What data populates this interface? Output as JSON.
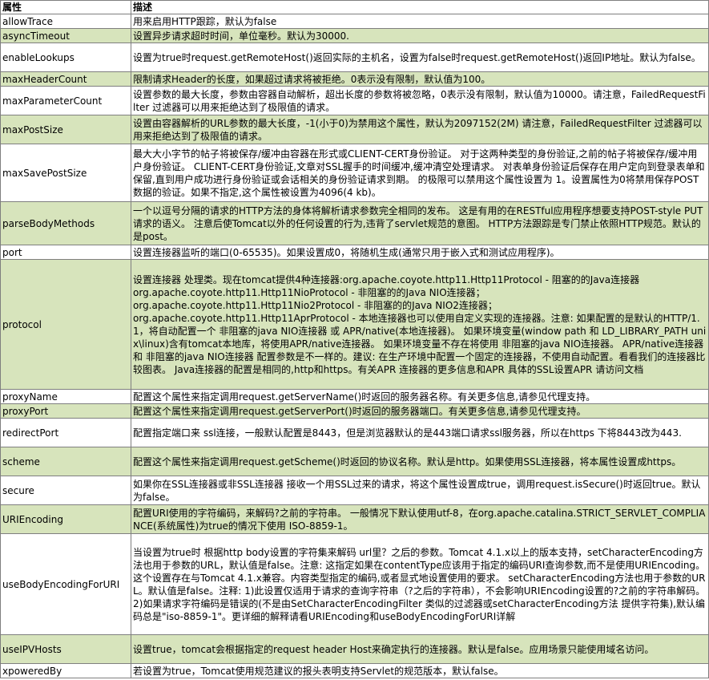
{
  "table": {
    "headers": [
      "属性",
      "描述"
    ],
    "rows": [
      {
        "property": "allowTrace",
        "description": "用来启用HTTP跟踪，默认为false"
      },
      {
        "property": "asyncTimeout",
        "description": "设置异步请求超时时间，单位毫秒。默认为30000."
      },
      {
        "property": "enableLookups",
        "description": "设置为true时request.getRemoteHost()返回实际的主机名，设置为false时request.getRemoteHost()返回IP地址。默认为false。"
      },
      {
        "property": "maxHeaderCount",
        "description": "限制请求Header的长度，如果超过请求将被拒绝。0表示没有限制，默认值为100。"
      },
      {
        "property": "maxParameterCount",
        "description": "设置参数的最大长度，参数由容器自动解析，超出长度的参数将被忽略，0表示没有限制，默认值为10000。请注意，FailedRequestFilter 过滤器可以用来拒绝达到了极限值的请求。"
      },
      {
        "property": "maxPostSize",
        "description": "设置由容器解析的URL参数的最大长度，-1(小于0)为禁用这个属性，默认为2097152(2M) 请注意，FailedRequestFilter 过滤器可以用来拒绝达到了极限值的请求。"
      },
      {
        "property": "maxSavePostSize",
        "description": "最大大小字节的帖子将被保存/缓冲由容器在形式或CLIENT-CERT身份验证。 对于这两种类型的身份验证,之前的帖子将被保存/缓冲用户身份验证。 CLIENT-CERT身份验证,文章对SSL握手的时间缓冲,缓冲清空处理请求。 对表单身份验证后保存在用户定向到登录表单和保留,直到用户成功进行身份验证或会话相关的身份验证请求到期。 的极限可以禁用这个属性设置为 1。设置属性为0将禁用保存POST数据的验证。如果不指定,这个属性被设置为4096(4 kb)。"
      },
      {
        "property": "parseBodyMethods",
        "description": "一个以逗号分隔的请求的HTTP方法的身体将解析请求参数完全相同的发布。 这是有用的在RESTful应用程序想要支持POST-style PUT请求的语义。 注意后使Tomcat以外的任何设置的行为,违背了servlet规范的意图。 HTTP方法跟踪是专门禁止依照HTTP规范。默认的是post。"
      },
      {
        "property": "port",
        "description": "设置连接器监听的端口(0-65535)。如果设置成0，将随机生成(通常只用于嵌入式和测试应用程序)。"
      },
      {
        "property": "protocol",
        "description": "设置连接器 处理类。现在tomcat提供4种连接器:org.apache.coyote.http11.Http11Protocol - 阻塞的的Java连接器\norg.apache.coyote.http11.Http11NioProtocol - 非阻塞的的Java NIO连接器；\norg.apache.coyote.http11.Http11Nio2Protocol - 非阻塞的的Java NIO2连接器；\norg.apache.coyote.http11.Http11AprProtocol - 本地连接器也可以使用自定义实现的连接器。注意: 如果配置的是默认的HTTP/1.1，将自动配置一个 非阻塞的java NIO连接器 或 APR/native(本地连接器)。 如果环境变量(window path 和 LD_LIBRARY_PATH unix\\linux)含有tomcat本地库，将使用APR/native连接器。 如果环境变量不存在将使用 非阻塞的java NIO连接器。 APR/native连接器 和 非阻塞的java NIO连接器 配置参数是不一样的。建议: 在生产环境中配置一个固定的连接器，不使用自动配置。看看我们的连接器比较图表。 Java连接器的配置是相同的,http和https。有关APR 连接器的更多信息和APR 具体的SSL设置APR 请访问文档"
      },
      {
        "property": "proxyName",
        "description": "配置这个属性来指定调用request.getServerName()时返回的服务器名称。有关更多信息,请参见代理支持。"
      },
      {
        "property": "proxyPort",
        "description": "配置这个属性来指定调用request.getServerPort()时返回的服务器端口。有关更多信息,请参见代理支持。"
      },
      {
        "property": "redirectPort",
        "description": "配置指定端口来 ssl连接，一般默认配置是8443，但是浏览器默认的是443端口请求ssl服务器，所以在https 下将8443改为443."
      },
      {
        "property": "scheme",
        "description": "配置这个属性来指定调用request.getScheme()时返回的协议名称。默认是http。如果使用SSL连接器，将本属性设置成https。"
      },
      {
        "property": "secure",
        "description": "如果你在SSL连接器或非SSL连接器 接收一个用SSL过来的请求，将这个属性设置成true，调用request.isSecure()时返回true。默认为false。"
      },
      {
        "property": "URIEncoding",
        "description": "配置URI使用的字符编码，来解码?之前的字符串。 一般情况下默认使用utf-8，在org.apache.catalina.STRICT_SERVLET_COMPLIANCE(系统属性)为true的情况下使用 ISO-8859-1。"
      },
      {
        "property": "useBodyEncodingForURI",
        "description": "当设置为true时 根据http body设置的字符集来解码 url里？之后的参数。Tomcat 4.1.x以上的版本支持，setCharacterEncoding方法也用于参数的URL，默认值是false。注意: 这指定如果在contentType应该用于指定的编码URI查询参数,而不是使用URIEncoding。 这个设置存在与Tomcat 4.1.x兼容。内容类型指定的编码,或者显式地设置使用的要求。 setCharacterEncoding方法也用于参数的URL。默认值是false。注释: 1)此设置仅适用于请求的查询字符串（?之后的字符串），不会影响URIEncoding设置的?之前的字符串解码。2)如果请求字符编码是错误的(不是由SetCharacterEncodingFilter 类似的过滤器或setCharacterEncoding方法 提供字符集),默认编码总是\"iso-8859-1\"。更详细的解释请看URIEncoding和useBodyEncodingForURI详解"
      },
      {
        "property": "useIPVHosts",
        "description": "设置true，tomcat会根据指定的request header Host来确定执行的连接器。默认是false。应用场景只能使用域名访问。"
      },
      {
        "property": "xpoweredBy",
        "description": "若设置为true，Tomcat使用规范建议的报头表明支持Servlet的规范版本，默认false。"
      }
    ]
  },
  "colors": {
    "alt_row": "#d7e4bc",
    "border": "#7f7f7f"
  }
}
